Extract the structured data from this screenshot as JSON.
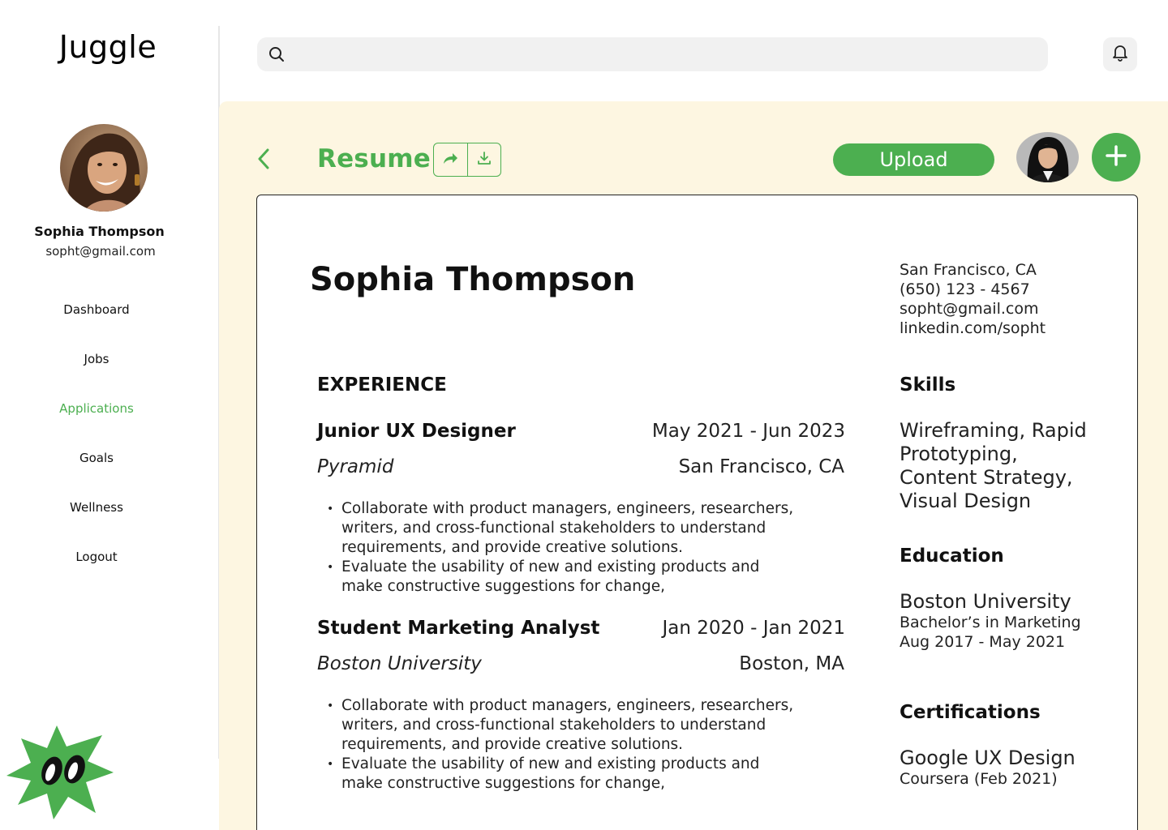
{
  "app": {
    "name": "Juggle"
  },
  "user": {
    "name": "Sophia Thompson",
    "email": "sopht@gmail.com"
  },
  "nav": {
    "items": [
      {
        "label": "Dashboard",
        "active": false
      },
      {
        "label": "Jobs",
        "active": false
      },
      {
        "label": "Applications",
        "active": true
      },
      {
        "label": "Goals",
        "active": false
      },
      {
        "label": "Wellness",
        "active": false
      },
      {
        "label": "Logout",
        "active": false
      }
    ]
  },
  "search": {
    "placeholder": "",
    "value": ""
  },
  "icons": {
    "search": "search-icon",
    "bell": "bell-icon",
    "back": "chevron-left-icon",
    "share": "share-icon",
    "download": "download-icon",
    "add": "plus-icon"
  },
  "toolbar": {
    "title": "Resume",
    "upload_label": "Upload"
  },
  "resume": {
    "name": "Sophia Thompson",
    "contact": {
      "location": "San Francisco, CA",
      "phone": "(650) 123 - 4567",
      "email": "sopht@gmail.com",
      "linkedin": "linkedin.com/sopht"
    },
    "experience_heading": "EXPERIENCE",
    "jobs": [
      {
        "title": "Junior UX Designer",
        "dates": "May 2021 - Jun 2023",
        "company": "Pyramid",
        "location": "San Francisco, CA",
        "bullets": [
          "Collaborate with product managers, engineers, researchers,\nwriters, and cross-functional stakeholders to understand\nrequirements, and provide creative solutions.",
          "Evaluate the usability of new and existing products and\nmake constructive suggestions for change,"
        ]
      },
      {
        "title": "Student Marketing Analyst",
        "dates": "Jan 2020 - Jan 2021",
        "company": "Boston University",
        "location": "Boston, MA",
        "bullets": [
          "Collaborate with product managers, engineers, researchers,\nwriters, and cross-functional stakeholders to understand\nrequirements, and provide creative solutions.",
          "Evaluate the usability of new and existing products and\nmake constructive suggestions for change,"
        ]
      }
    ],
    "skills_heading": "Skills",
    "skills_lines": [
      "Wireframing, Rapid",
      "Prototyping,",
      "Content Strategy,",
      "Visual Design"
    ],
    "education_heading": "Education",
    "education": {
      "school": "Boston University",
      "degree": "Bachelor’s in Marketing",
      "dates": "Aug 2017 - May 2021"
    },
    "certifications_heading": "Certifications",
    "certification": {
      "name": "Google UX Design",
      "issuer": "Coursera (Feb 2021)"
    }
  },
  "colors": {
    "accent": "#4caf50",
    "panel_bg": "#fdf6e1",
    "search_bg": "#f1f1f1"
  }
}
